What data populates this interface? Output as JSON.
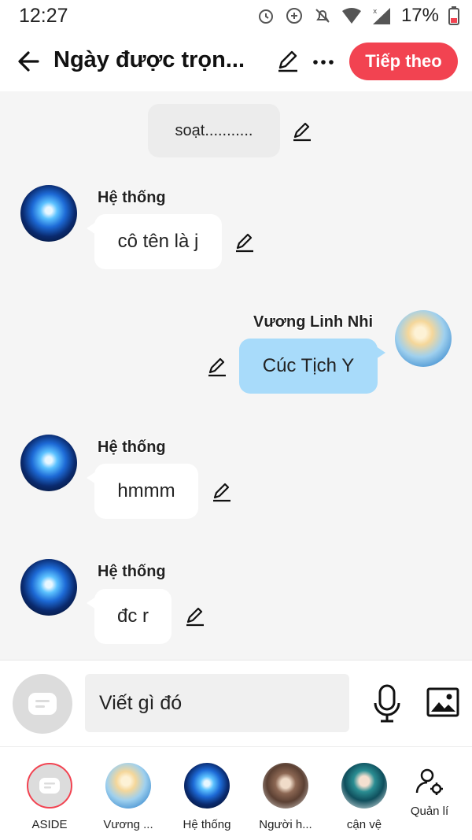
{
  "status_bar": {
    "time": "12:27",
    "battery_percent": "17%"
  },
  "header": {
    "title": "Ngày được trọn...",
    "next_button": "Tiếp theo",
    "accent_color": "#f24351"
  },
  "messages": [
    {
      "type": "system",
      "text": "soạt..........."
    },
    {
      "type": "left",
      "sender": "Hệ thống",
      "text": "cô tên là j"
    },
    {
      "type": "right",
      "sender": "Vương Linh Nhi",
      "text": "Cúc Tịch Y"
    },
    {
      "type": "left",
      "sender": "Hệ thống",
      "text": "hmmm"
    },
    {
      "type": "left",
      "sender": "Hệ thống",
      "text": "đc r"
    }
  ],
  "composer": {
    "placeholder": "Viết gì đó"
  },
  "characters": [
    {
      "label": "ASIDE"
    },
    {
      "label": "Vương ..."
    },
    {
      "label": "Hệ thống"
    },
    {
      "label": "Người h..."
    },
    {
      "label": "cận vệ"
    },
    {
      "label": "Quản lí"
    }
  ]
}
